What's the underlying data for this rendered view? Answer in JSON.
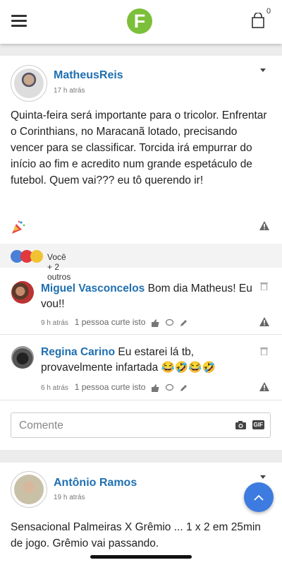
{
  "header": {
    "logo_letter": "F",
    "cart_count": "0",
    "brand_color": "#7cbf3a"
  },
  "post1": {
    "author": "MatheusReis",
    "time": "17 h atrás",
    "text": "Quinta-feira será importante para o tricolor. Enfrentar o Corinthians, no Maracanã lotado, precisando vencer para se classificar. Torcida irá empurrar do início ao fim e acredito num grande espetáculo de futebol. Quem vai??? eu tô querendo ir!",
    "reaction_summary": "Você + 2 outros",
    "comments": [
      {
        "author": "Miguel Vasconcelos",
        "text": "Bom dia Matheus! Eu vou!!",
        "time": "9 h atrás",
        "likes": "1 pessoa curte isto"
      },
      {
        "author": "Regina Carino",
        "text": "Eu estarei lá tb, provavelmente infartada 😂🤣😂🤣",
        "time": "6 h atrás",
        "likes": "1 pessoa curte isto"
      }
    ],
    "comment_placeholder": "Comente",
    "gif_label": "GIF"
  },
  "post2": {
    "author": "Antônio Ramos",
    "time": "19 h atrás",
    "text": "Sensacional Palmeiras X Grêmio ... 1 x 2 em 25min de jogo. Grêmio vai passando."
  },
  "icons": [
    "menu-icon",
    "cart-icon",
    "caret-down-icon",
    "warning-icon",
    "trash-icon",
    "like-icon",
    "reply-icon",
    "edit-icon",
    "camera-icon",
    "arrow-up-icon"
  ],
  "colors": {
    "link": "#1f6fb0",
    "fab": "#3d7be0"
  }
}
